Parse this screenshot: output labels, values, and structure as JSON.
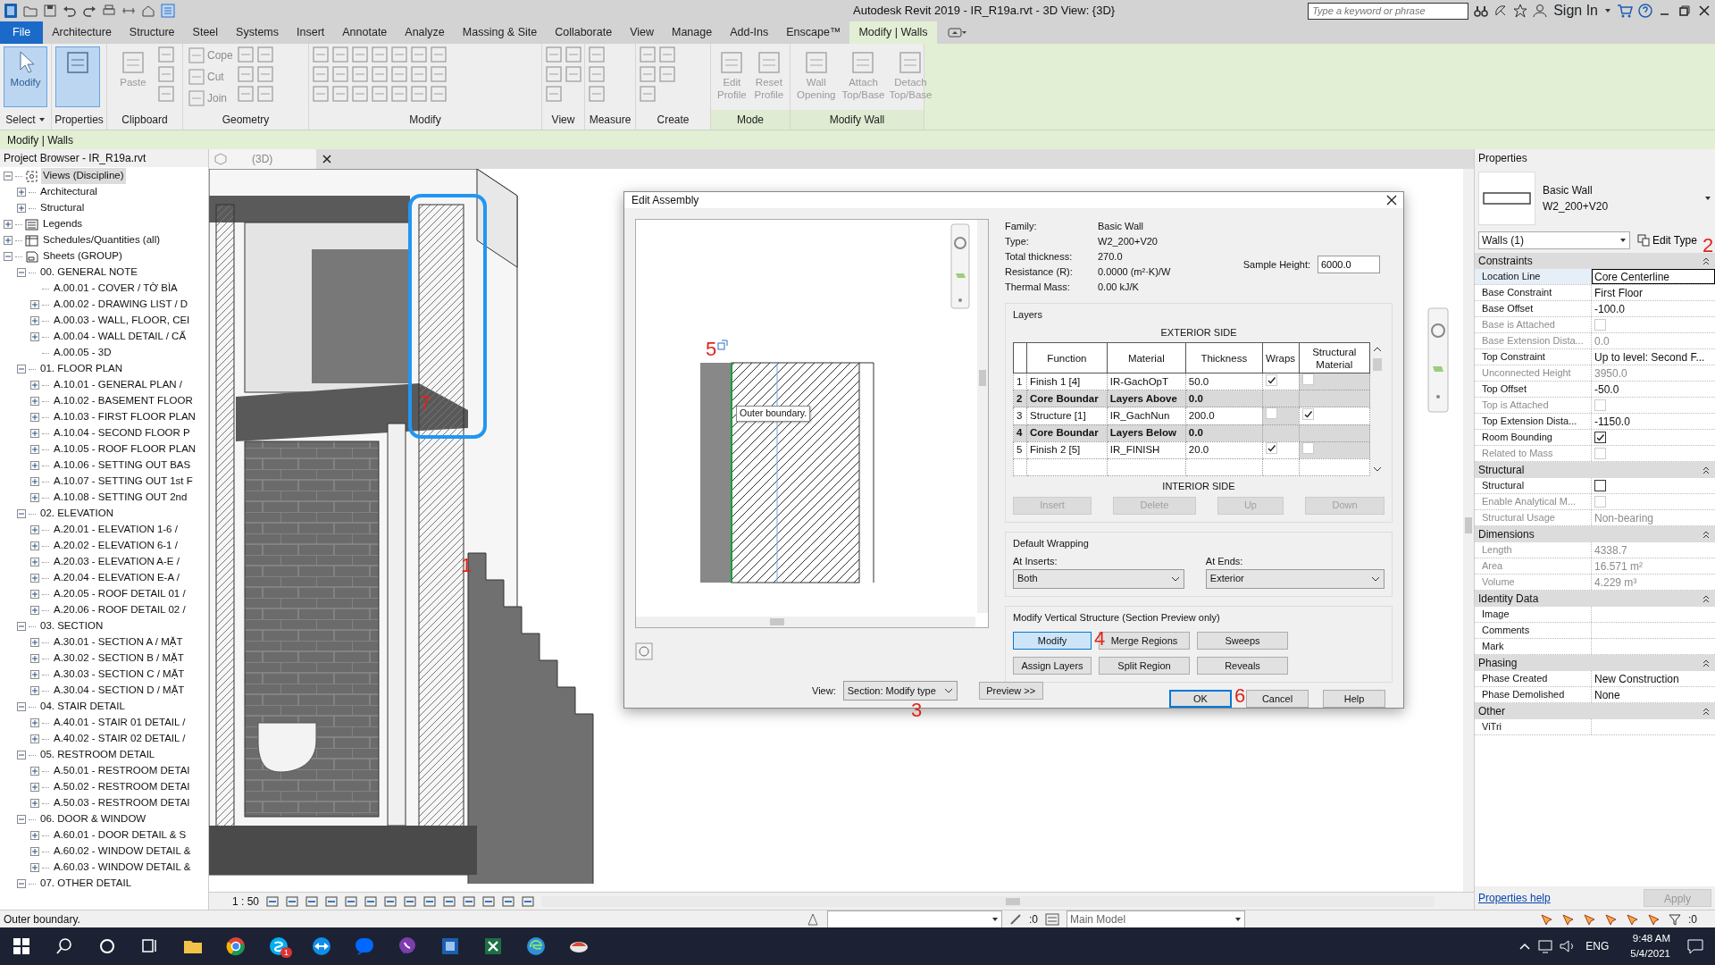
{
  "title_bar": {
    "title": "Autodesk Revit 2019 - IR_R19a.rvt - 3D View: {3D}",
    "search": {
      "placeholder": "Type a keyword or phrase"
    },
    "sign_in": "Sign In"
  },
  "ribbon_tabs": [
    {
      "label": "File",
      "kind": "file",
      "selected": false
    },
    {
      "label": "Architecture",
      "kind": "tab",
      "selected": false
    },
    {
      "label": "Structure",
      "kind": "tab",
      "selected": false
    },
    {
      "label": "Steel",
      "kind": "tab",
      "selected": false
    },
    {
      "label": "Systems",
      "kind": "tab",
      "selected": false
    },
    {
      "label": "Insert",
      "kind": "tab",
      "selected": false
    },
    {
      "label": "Annotate",
      "kind": "tab",
      "selected": false
    },
    {
      "label": "Analyze",
      "kind": "tab",
      "selected": false
    },
    {
      "label": "Massing & Site",
      "kind": "tab",
      "selected": false
    },
    {
      "label": "Collaborate",
      "kind": "tab",
      "selected": false
    },
    {
      "label": "View",
      "kind": "tab",
      "selected": false
    },
    {
      "label": "Manage",
      "kind": "tab",
      "selected": false
    },
    {
      "label": "Add-Ins",
      "kind": "tab",
      "selected": false
    },
    {
      "label": "Enscape™",
      "kind": "tab",
      "selected": false
    },
    {
      "label": "Modify | Walls",
      "kind": "tab",
      "selected": true
    }
  ],
  "ribbon_panels": [
    {
      "label": "Select",
      "dropdown": true,
      "contextual": false,
      "tools": [
        {
          "label": "Modify",
          "kind": "large",
          "disabled": false,
          "active": true
        }
      ]
    },
    {
      "label": "Properties",
      "dropdown": false,
      "contextual": false,
      "tools": [
        {
          "kind": "large",
          "disabled": false,
          "active": true
        }
      ]
    },
    {
      "label": "Clipboard",
      "dropdown": false,
      "contextual": false,
      "tools": [
        {
          "label": "Paste",
          "kind": "large",
          "disabled": true,
          "active": false
        }
      ]
    },
    {
      "label": "Geometry",
      "dropdown": false,
      "contextual": false,
      "tools": [
        {
          "label": "Cope",
          "kind": "small",
          "disabled": true,
          "active": false
        },
        {
          "label": "Cut",
          "kind": "small",
          "disabled": true,
          "active": false
        },
        {
          "label": "Join",
          "kind": "small",
          "disabled": true,
          "active": false
        }
      ]
    },
    {
      "label": "Modify",
      "dropdown": false,
      "contextual": false
    },
    {
      "label": "View",
      "dropdown": false,
      "contextual": false
    },
    {
      "label": "Measure",
      "dropdown": false,
      "contextual": false
    },
    {
      "label": "Create",
      "dropdown": false,
      "contextual": false
    },
    {
      "label": "Mode",
      "dropdown": false,
      "contextual": true,
      "tools": [
        {
          "label": "Edit Profile",
          "kind": "large",
          "disabled": true,
          "active": false
        },
        {
          "label": "Reset Profile",
          "kind": "large",
          "disabled": true,
          "active": false
        }
      ]
    },
    {
      "label": "Modify Wall",
      "dropdown": false,
      "contextual": true,
      "tools": [
        {
          "label": "Wall Opening",
          "kind": "large",
          "disabled": true,
          "active": false
        },
        {
          "label": "Attach Top/Base",
          "kind": "large",
          "disabled": true,
          "active": false
        },
        {
          "label": "Detach Top/Base",
          "kind": "large",
          "disabled": true,
          "active": false
        }
      ]
    }
  ],
  "context_bar": "Modify | Walls",
  "project_browser": {
    "title": "Project Browser - IR_R19a.rvt",
    "tree": [
      {
        "label": "Views (Discipline)",
        "kind": "views",
        "expanded": true,
        "selected": true,
        "children": [
          {
            "label": "Architectural",
            "expanded": false,
            "selected": false
          },
          {
            "label": "Structural",
            "expanded": false,
            "selected": false
          }
        ]
      },
      {
        "label": "Legends",
        "kind": "legends",
        "expanded": false,
        "selected": false
      },
      {
        "label": "Schedules/Quantities (all)",
        "kind": "schedules",
        "expanded": false,
        "selected": false
      },
      {
        "label": "Sheets (GROUP)",
        "kind": "sheets",
        "expanded": true,
        "selected": false,
        "children": [
          {
            "label": "00. GENERAL NOTE",
            "expanded": true,
            "selected": false,
            "children": [
              {
                "label": "A.00.01 - COVER / TỜ BÌA",
                "selected": false
              },
              {
                "label": "A.00.02 - DRAWING LIST / D",
                "expanded": false,
                "selected": false
              },
              {
                "label": "A.00.03 - WALL, FLOOR, CEI",
                "expanded": false,
                "selected": false
              },
              {
                "label": "A.00.04 - WALL DETAIL / CẤ",
                "expanded": false,
                "selected": false
              },
              {
                "label": "A.00.05 - 3D",
                "selected": false
              }
            ]
          },
          {
            "label": "01. FLOOR PLAN",
            "expanded": true,
            "selected": false,
            "children": [
              {
                "label": "A.10.01 - GENERAL PLAN /",
                "expanded": false,
                "selected": false
              },
              {
                "label": "A.10.02 - BASEMENT FLOOR",
                "expanded": false,
                "selected": false
              },
              {
                "label": "A.10.03 - FIRST FLOOR PLAN",
                "expanded": false,
                "selected": false
              },
              {
                "label": "A.10.04 - SECOND FLOOR P",
                "expanded": false,
                "selected": false
              },
              {
                "label": "A.10.05 - ROOF FLOOR PLAN",
                "expanded": false,
                "selected": false
              },
              {
                "label": "A.10.06 - SETTING OUT BAS",
                "expanded": false,
                "selected": false
              },
              {
                "label": "A.10.07 - SETTING OUT 1st F",
                "expanded": false,
                "selected": false
              },
              {
                "label": "A.10.08 - SETTING OUT 2nd",
                "expanded": false,
                "selected": false
              }
            ]
          },
          {
            "label": "02. ELEVATION",
            "expanded": true,
            "selected": false,
            "children": [
              {
                "label": "A.20.01 - ELEVATION 1-6 /",
                "expanded": false,
                "selected": false
              },
              {
                "label": "A.20.02 - ELEVATION 6-1 /",
                "expanded": false,
                "selected": false
              },
              {
                "label": "A.20.03 - ELEVATION A-E /",
                "expanded": false,
                "selected": false
              },
              {
                "label": "A.20.04 - ELEVATION E-A /",
                "expanded": false,
                "selected": false
              },
              {
                "label": "A.20.05 - ROOF DETAIL 01 /",
                "expanded": false,
                "selected": false
              },
              {
                "label": "A.20.06 - ROOF DETAIL 02 /",
                "expanded": false,
                "selected": false
              }
            ]
          },
          {
            "label": "03. SECTION",
            "expanded": true,
            "selected": false,
            "children": [
              {
                "label": "A.30.01 - SECTION A / MẶT",
                "expanded": false,
                "selected": false
              },
              {
                "label": "A.30.02 - SECTION B / MẶT",
                "expanded": false,
                "selected": false
              },
              {
                "label": "A.30.03 - SECTION C / MẶT",
                "expanded": false,
                "selected": false
              },
              {
                "label": "A.30.04 - SECTION D / MẶT",
                "expanded": false,
                "selected": false
              }
            ]
          },
          {
            "label": "04. STAIR DETAIL",
            "expanded": true,
            "selected": false,
            "children": [
              {
                "label": "A.40.01 - STAIR 01 DETAIL /",
                "expanded": false,
                "selected": false
              },
              {
                "label": "A.40.02 - STAIR 02 DETAIL /",
                "expanded": false,
                "selected": false
              }
            ]
          },
          {
            "label": "05. RESTROOM DETAIL",
            "expanded": true,
            "selected": false,
            "children": [
              {
                "label": "A.50.01 - RESTROOM DETAI",
                "expanded": false,
                "selected": false
              },
              {
                "label": "A.50.02 - RESTROOM DETAI",
                "expanded": false,
                "selected": false
              },
              {
                "label": "A.50.03 - RESTROOM DETAI",
                "expanded": false,
                "selected": false
              }
            ]
          },
          {
            "label": "06. DOOR & WINDOW",
            "expanded": true,
            "selected": false,
            "children": [
              {
                "label": "A.60.01 - DOOR DETAIL & S",
                "expanded": false,
                "selected": false
              },
              {
                "label": "A.60.02 - WINDOW DETAIL &",
                "expanded": false,
                "selected": false
              },
              {
                "label": "A.60.03 - WINDOW DETAIL &",
                "expanded": false,
                "selected": false
              }
            ]
          },
          {
            "label": "07. OTHER DETAIL",
            "expanded": true,
            "selected": false
          }
        ]
      }
    ]
  },
  "view": {
    "tab": "(3D)",
    "scale": "1 : 50"
  },
  "callouts": [
    {
      "label": "1"
    },
    {
      "label": "2"
    },
    {
      "label": "3"
    },
    {
      "label": "4"
    },
    {
      "label": "5"
    },
    {
      "label": "6"
    },
    {
      "label": "7"
    }
  ],
  "dialog": {
    "title": "Edit Assembly",
    "tooltip": "Outer boundary.",
    "info": [
      {
        "label": "Family:",
        "value": "Basic Wall"
      },
      {
        "label": "Type:",
        "value": "W2_200+V20"
      },
      {
        "label": "Total thickness:",
        "value": "270.0"
      },
      {
        "label": "Resistance (R):",
        "value": "0.0000 (m²·K)/W"
      },
      {
        "label": "Thermal Mass:",
        "value": "0.00 kJ/K"
      }
    ],
    "sample_height": {
      "label": "Sample Height:",
      "value": "6000.0"
    },
    "layers": {
      "title": "Layers",
      "exterior": "EXTERIOR SIDE",
      "interior": "INTERIOR SIDE",
      "columns": [
        "Function",
        "Material",
        "Thickness",
        "Wraps",
        "Structural Material"
      ],
      "rows": [
        {
          "index": "1",
          "kind": "layer",
          "function": "Finish 1 [4]",
          "material": "IR-GachOpT",
          "thickness": "50.0",
          "wraps": true,
          "structural": false
        },
        {
          "index": "2",
          "kind": "core",
          "function": "Core Boundar",
          "material": "Layers Above",
          "thickness": "0.0"
        },
        {
          "index": "3",
          "kind": "layer",
          "function": "Structure [1]",
          "material": "IR_GachNun",
          "thickness": "200.0",
          "wraps": false,
          "structural": true
        },
        {
          "index": "4",
          "kind": "core",
          "function": "Core Boundar",
          "material": "Layers Below",
          "thickness": "0.0"
        },
        {
          "index": "5",
          "kind": "layer",
          "function": "Finish 2 [5]",
          "material": "IR_FINISH",
          "thickness": "20.0",
          "wraps": true,
          "structural": false
        }
      ],
      "buttons": [
        {
          "label": "Insert",
          "disabled": true
        },
        {
          "label": "Delete",
          "disabled": true
        },
        {
          "label": "Up",
          "disabled": true
        },
        {
          "label": "Down",
          "disabled": true
        }
      ]
    },
    "wrapping": {
      "title": "Default Wrapping",
      "inserts": {
        "label": "At Inserts:",
        "value": "Both"
      },
      "ends": {
        "label": "At Ends:",
        "value": "Exterior"
      }
    },
    "vertical": {
      "title": "Modify Vertical Structure (Section Preview only)",
      "buttons": [
        {
          "label": "Modify",
          "selected": true
        },
        {
          "label": "Merge Regions",
          "selected": false
        },
        {
          "label": "Sweeps",
          "selected": false
        },
        {
          "label": "Assign Layers",
          "selected": false
        },
        {
          "label": "Split Region",
          "selected": false
        },
        {
          "label": "Reveals",
          "selected": false
        }
      ]
    },
    "actions": [
      {
        "label": "OK",
        "default": true
      },
      {
        "label": "Cancel",
        "default": false
      },
      {
        "label": "Help",
        "default": false
      }
    ],
    "view": {
      "label": "View:",
      "value": "Section: Modify type"
    },
    "preview_button": "Preview >>"
  },
  "properties": {
    "title": "Properties",
    "family": "Basic Wall",
    "type": "W2_200+V20",
    "filter": "Walls (1)",
    "edit_type": "Edit Type",
    "sections": [
      {
        "label": "Constraints",
        "rows": [
          {
            "name": "Location Line",
            "kind": "text",
            "value": "Core Centerline",
            "disabled": false,
            "selected": true
          },
          {
            "name": "Base Constraint",
            "kind": "text",
            "value": "First Floor",
            "disabled": false,
            "selected": false
          },
          {
            "name": "Base Offset",
            "kind": "text",
            "value": "-100.0",
            "disabled": false,
            "selected": false
          },
          {
            "name": "Base is Attached",
            "kind": "check",
            "checked": false,
            "disabled": true,
            "selected": false
          },
          {
            "name": "Base Extension Dista...",
            "kind": "text",
            "value": "0.0",
            "disabled": true,
            "selected": false
          },
          {
            "name": "Top Constraint",
            "kind": "text",
            "value": "Up to level: Second F...",
            "disabled": false,
            "selected": false
          },
          {
            "name": "Unconnected Height",
            "kind": "text",
            "value": "3950.0",
            "disabled": true,
            "selected": false
          },
          {
            "name": "Top Offset",
            "kind": "text",
            "value": "-50.0",
            "disabled": false,
            "selected": false
          },
          {
            "name": "Top is Attached",
            "kind": "check",
            "checked": false,
            "disabled": true,
            "selected": false
          },
          {
            "name": "Top Extension Dista...",
            "kind": "text",
            "value": "-1150.0",
            "disabled": false,
            "selected": false
          },
          {
            "name": "Room Bounding",
            "kind": "check",
            "checked": true,
            "disabled": false,
            "selected": false
          },
          {
            "name": "Related to Mass",
            "kind": "check",
            "checked": false,
            "disabled": true,
            "selected": false
          }
        ]
      },
      {
        "label": "Structural",
        "rows": [
          {
            "name": "Structural",
            "kind": "check",
            "checked": false,
            "disabled": false,
            "selected": false
          },
          {
            "name": "Enable Analytical M...",
            "kind": "check",
            "checked": false,
            "disabled": true,
            "selected": false
          },
          {
            "name": "Structural Usage",
            "kind": "text",
            "value": "Non-bearing",
            "disabled": true,
            "selected": false
          }
        ]
      },
      {
        "label": "Dimensions",
        "rows": [
          {
            "name": "Length",
            "kind": "text",
            "value": "4338.7",
            "disabled": true,
            "selected": false
          },
          {
            "name": "Area",
            "kind": "text",
            "value": "16.571 m²",
            "disabled": true,
            "selected": false
          },
          {
            "name": "Volume",
            "kind": "text",
            "value": "4.229 m³",
            "disabled": true,
            "selected": false
          }
        ]
      },
      {
        "label": "Identity Data",
        "rows": [
          {
            "name": "Image",
            "kind": "text",
            "disabled": false,
            "selected": false
          },
          {
            "name": "Comments",
            "kind": "text",
            "disabled": false,
            "selected": false
          },
          {
            "name": "Mark",
            "kind": "text",
            "disabled": false,
            "selected": false
          }
        ]
      },
      {
        "label": "Phasing",
        "rows": [
          {
            "name": "Phase Created",
            "kind": "text",
            "value": "New Construction",
            "disabled": false,
            "selected": false
          },
          {
            "name": "Phase Demolished",
            "kind": "text",
            "value": "None",
            "disabled": false,
            "selected": false
          }
        ]
      },
      {
        "label": "Other",
        "rows": [
          {
            "name": "ViTri",
            "kind": "text",
            "disabled": false,
            "selected": false
          }
        ]
      }
    ],
    "help": "Properties help",
    "apply": {
      "label": "Apply",
      "disabled": true
    }
  },
  "status_bar": {
    "message": "Outer boundary.",
    "count": ":0",
    "model": "Main Model",
    "filter_count": ":0"
  },
  "taskbar": {
    "badge": "1",
    "language": "ENG",
    "time": "9:48 AM",
    "date": "5/4/2021"
  }
}
